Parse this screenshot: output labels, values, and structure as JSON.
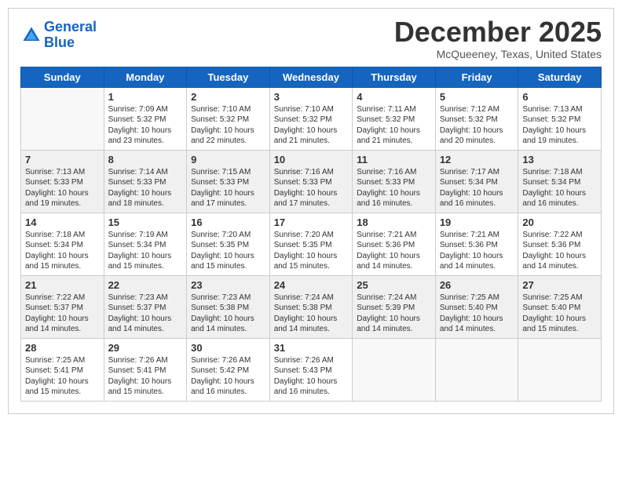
{
  "logo": {
    "line1": "General",
    "line2": "Blue"
  },
  "title": "December 2025",
  "subtitle": "McQueeney, Texas, United States",
  "days_of_week": [
    "Sunday",
    "Monday",
    "Tuesday",
    "Wednesday",
    "Thursday",
    "Friday",
    "Saturday"
  ],
  "weeks": [
    {
      "shaded": false,
      "days": [
        {
          "num": "",
          "info": ""
        },
        {
          "num": "1",
          "info": "Sunrise: 7:09 AM\nSunset: 5:32 PM\nDaylight: 10 hours\nand 23 minutes."
        },
        {
          "num": "2",
          "info": "Sunrise: 7:10 AM\nSunset: 5:32 PM\nDaylight: 10 hours\nand 22 minutes."
        },
        {
          "num": "3",
          "info": "Sunrise: 7:10 AM\nSunset: 5:32 PM\nDaylight: 10 hours\nand 21 minutes."
        },
        {
          "num": "4",
          "info": "Sunrise: 7:11 AM\nSunset: 5:32 PM\nDaylight: 10 hours\nand 21 minutes."
        },
        {
          "num": "5",
          "info": "Sunrise: 7:12 AM\nSunset: 5:32 PM\nDaylight: 10 hours\nand 20 minutes."
        },
        {
          "num": "6",
          "info": "Sunrise: 7:13 AM\nSunset: 5:32 PM\nDaylight: 10 hours\nand 19 minutes."
        }
      ]
    },
    {
      "shaded": true,
      "days": [
        {
          "num": "7",
          "info": "Sunrise: 7:13 AM\nSunset: 5:33 PM\nDaylight: 10 hours\nand 19 minutes."
        },
        {
          "num": "8",
          "info": "Sunrise: 7:14 AM\nSunset: 5:33 PM\nDaylight: 10 hours\nand 18 minutes."
        },
        {
          "num": "9",
          "info": "Sunrise: 7:15 AM\nSunset: 5:33 PM\nDaylight: 10 hours\nand 17 minutes."
        },
        {
          "num": "10",
          "info": "Sunrise: 7:16 AM\nSunset: 5:33 PM\nDaylight: 10 hours\nand 17 minutes."
        },
        {
          "num": "11",
          "info": "Sunrise: 7:16 AM\nSunset: 5:33 PM\nDaylight: 10 hours\nand 16 minutes."
        },
        {
          "num": "12",
          "info": "Sunrise: 7:17 AM\nSunset: 5:34 PM\nDaylight: 10 hours\nand 16 minutes."
        },
        {
          "num": "13",
          "info": "Sunrise: 7:18 AM\nSunset: 5:34 PM\nDaylight: 10 hours\nand 16 minutes."
        }
      ]
    },
    {
      "shaded": false,
      "days": [
        {
          "num": "14",
          "info": "Sunrise: 7:18 AM\nSunset: 5:34 PM\nDaylight: 10 hours\nand 15 minutes."
        },
        {
          "num": "15",
          "info": "Sunrise: 7:19 AM\nSunset: 5:34 PM\nDaylight: 10 hours\nand 15 minutes."
        },
        {
          "num": "16",
          "info": "Sunrise: 7:20 AM\nSunset: 5:35 PM\nDaylight: 10 hours\nand 15 minutes."
        },
        {
          "num": "17",
          "info": "Sunrise: 7:20 AM\nSunset: 5:35 PM\nDaylight: 10 hours\nand 15 minutes."
        },
        {
          "num": "18",
          "info": "Sunrise: 7:21 AM\nSunset: 5:36 PM\nDaylight: 10 hours\nand 14 minutes."
        },
        {
          "num": "19",
          "info": "Sunrise: 7:21 AM\nSunset: 5:36 PM\nDaylight: 10 hours\nand 14 minutes."
        },
        {
          "num": "20",
          "info": "Sunrise: 7:22 AM\nSunset: 5:36 PM\nDaylight: 10 hours\nand 14 minutes."
        }
      ]
    },
    {
      "shaded": true,
      "days": [
        {
          "num": "21",
          "info": "Sunrise: 7:22 AM\nSunset: 5:37 PM\nDaylight: 10 hours\nand 14 minutes."
        },
        {
          "num": "22",
          "info": "Sunrise: 7:23 AM\nSunset: 5:37 PM\nDaylight: 10 hours\nand 14 minutes."
        },
        {
          "num": "23",
          "info": "Sunrise: 7:23 AM\nSunset: 5:38 PM\nDaylight: 10 hours\nand 14 minutes."
        },
        {
          "num": "24",
          "info": "Sunrise: 7:24 AM\nSunset: 5:38 PM\nDaylight: 10 hours\nand 14 minutes."
        },
        {
          "num": "25",
          "info": "Sunrise: 7:24 AM\nSunset: 5:39 PM\nDaylight: 10 hours\nand 14 minutes."
        },
        {
          "num": "26",
          "info": "Sunrise: 7:25 AM\nSunset: 5:40 PM\nDaylight: 10 hours\nand 14 minutes."
        },
        {
          "num": "27",
          "info": "Sunrise: 7:25 AM\nSunset: 5:40 PM\nDaylight: 10 hours\nand 15 minutes."
        }
      ]
    },
    {
      "shaded": false,
      "days": [
        {
          "num": "28",
          "info": "Sunrise: 7:25 AM\nSunset: 5:41 PM\nDaylight: 10 hours\nand 15 minutes."
        },
        {
          "num": "29",
          "info": "Sunrise: 7:26 AM\nSunset: 5:41 PM\nDaylight: 10 hours\nand 15 minutes."
        },
        {
          "num": "30",
          "info": "Sunrise: 7:26 AM\nSunset: 5:42 PM\nDaylight: 10 hours\nand 16 minutes."
        },
        {
          "num": "31",
          "info": "Sunrise: 7:26 AM\nSunset: 5:43 PM\nDaylight: 10 hours\nand 16 minutes."
        },
        {
          "num": "",
          "info": ""
        },
        {
          "num": "",
          "info": ""
        },
        {
          "num": "",
          "info": ""
        }
      ]
    }
  ]
}
